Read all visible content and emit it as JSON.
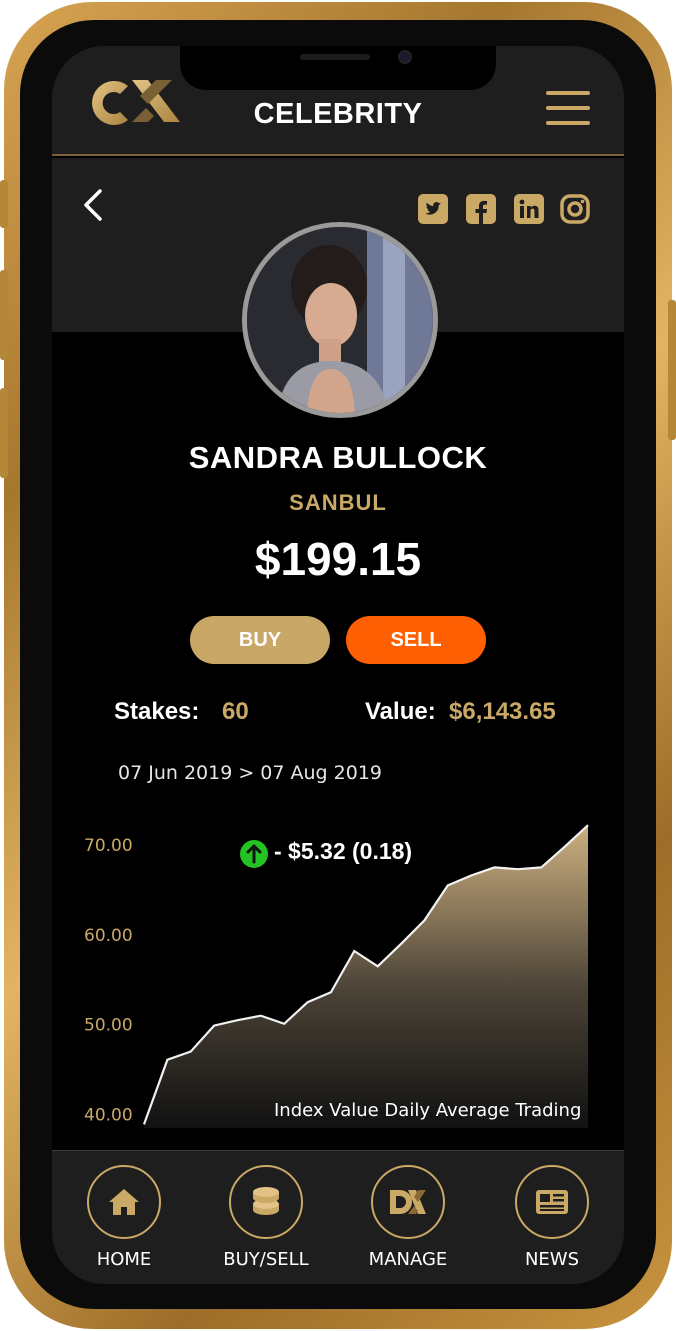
{
  "app": {
    "brand": "CX",
    "title": "CELEBRITY"
  },
  "header": {
    "menu_icon": "hamburger-menu-icon",
    "back_icon": "chevron-left-icon"
  },
  "social": [
    "twitter-icon",
    "facebook-icon",
    "linkedin-icon",
    "instagram-icon"
  ],
  "profile": {
    "name": "SANDRA BULLOCK",
    "ticker": "SANBUL",
    "price": "$199.15"
  },
  "actions": {
    "buy_label": "BUY",
    "sell_label": "SELL"
  },
  "stats": {
    "stakes_label": "Stakes:",
    "stakes_value": "60",
    "value_label": "Value:",
    "value_value": "$6,143.65"
  },
  "range": "07 Jun 2019 > 07 Aug 2019",
  "change": {
    "text": "- $5.32 (0.18)",
    "direction": "up"
  },
  "colors": {
    "gold": "#caa866",
    "sell": "#fd5f02",
    "up": "#22c322",
    "panel": "#1e1e1e"
  },
  "chart_data": {
    "type": "area",
    "title": "",
    "xlabel": "Index Value Daily Average Trading",
    "ylabel": "",
    "ylim": [
      38.5,
      73
    ],
    "yticks": [
      70,
      60,
      50,
      40
    ],
    "ytick_labels": [
      "70.00",
      "60.00",
      "50.00",
      "40.00"
    ],
    "x": [
      0,
      1,
      2,
      3,
      4,
      5,
      6,
      7,
      8,
      9,
      10,
      11,
      12,
      13,
      14,
      15,
      16,
      17,
      18,
      19
    ],
    "series": [
      {
        "values": [
          38.9,
          46.1,
          47.0,
          49.9,
          50.5,
          51.0,
          50.1,
          52.5,
          53.6,
          58.2,
          56.5,
          59.0,
          61.6,
          65.5,
          66.6,
          67.5,
          67.3,
          67.5,
          69.8,
          72.2
        ]
      }
    ],
    "grid": false,
    "legend": "none"
  },
  "nav": [
    {
      "label": "HOME",
      "icon": "home-icon"
    },
    {
      "label": "BUY/SELL",
      "icon": "coins-icon"
    },
    {
      "label": "MANAGE",
      "icon": "dx-logo-icon"
    },
    {
      "label": "NEWS",
      "icon": "newspaper-icon"
    }
  ]
}
